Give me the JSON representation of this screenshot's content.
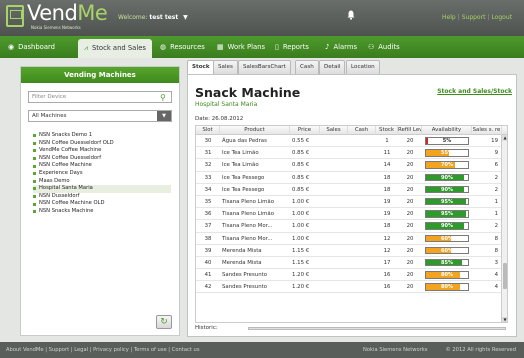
{
  "header": {
    "logo_main": "Vend",
    "logo_accent": "Me",
    "logo_sub": "Nokia Siemens Networks",
    "welcome_prefix": "Welcome:",
    "welcome_user": "test test",
    "links": [
      "Help",
      "Support",
      "Logout"
    ]
  },
  "nav": {
    "items": [
      {
        "label": "Dashboard",
        "icon": "eye-icon"
      },
      {
        "label": "Stock and Sales",
        "icon": "chart-icon"
      },
      {
        "label": "Resources",
        "icon": "globe-icon"
      },
      {
        "label": "Work Plans",
        "icon": "calendar-icon"
      },
      {
        "label": "Reports",
        "icon": "document-icon"
      },
      {
        "label": "Alarms",
        "icon": "bell-icon"
      },
      {
        "label": "Audits",
        "icon": "users-icon"
      }
    ]
  },
  "left_panel": {
    "title": "Vending Machines",
    "filter_placeholder": "Filter Device",
    "select_value": "All Machines",
    "machines": [
      "NSN Snacks Demo 1",
      "NSN Coffee Duesseldorf OLD",
      "VendMe Coffee Machine",
      "NSN Coffee Duesseldorf",
      "NSN Coffee Machine",
      "Experience Days",
      "Maas Demo",
      "Hospital Santa Maria",
      "NSN Dusseldorf",
      "NSN Coffee Machine OLD",
      "NSN Snacks Machine"
    ],
    "selected_index": 7
  },
  "tabs": [
    "Stock",
    "Sales",
    "SalesBarsChart",
    "Cash",
    "Detail",
    "Location Sales"
  ],
  "main": {
    "title": "Snack Machine",
    "subtitle": "Hospital Santa Maria",
    "date": "Date: 26.08.2012",
    "report_link": "Stock and Sales/Stock",
    "columns": [
      "Slot",
      "Product",
      "Price",
      "Sales",
      "Cash",
      "Stock",
      "Refill Lev",
      "Availability",
      "Sales s. re"
    ],
    "rows": [
      {
        "slot": "30",
        "product": "Água das Pedras",
        "price": "0.55 €",
        "stock": "1",
        "refill": "20",
        "avail": 5,
        "avail_label": "5%",
        "ssr": "19"
      },
      {
        "slot": "31",
        "product": "Ice Tea Limão",
        "price": "0.85 €",
        "stock": "11",
        "refill": "20",
        "avail": 55,
        "avail_label": "55%",
        "ssr": "9"
      },
      {
        "slot": "32",
        "product": "Ice Tea Limão",
        "price": "0.85 €",
        "stock": "14",
        "refill": "20",
        "avail": 70,
        "avail_label": "70%",
        "ssr": "6"
      },
      {
        "slot": "33",
        "product": "Ice Tea Pessego",
        "price": "0.85 €",
        "stock": "18",
        "refill": "20",
        "avail": 90,
        "avail_label": "90%",
        "ssr": "2"
      },
      {
        "slot": "34",
        "product": "Ice Tea Pessego",
        "price": "0.85 €",
        "stock": "18",
        "refill": "20",
        "avail": 90,
        "avail_label": "90%",
        "ssr": "2"
      },
      {
        "slot": "35",
        "product": "Tisana Pleno Limão",
        "price": "1.00 €",
        "stock": "19",
        "refill": "20",
        "avail": 95,
        "avail_label": "95%",
        "ssr": "1"
      },
      {
        "slot": "36",
        "product": "Tisana Pleno Limão",
        "price": "1.00 €",
        "stock": "19",
        "refill": "20",
        "avail": 95,
        "avail_label": "95%",
        "ssr": "1"
      },
      {
        "slot": "37",
        "product": "Tisana Pleno Mor...",
        "price": "1.00 €",
        "stock": "18",
        "refill": "20",
        "avail": 90,
        "avail_label": "90%",
        "ssr": "2"
      },
      {
        "slot": "38",
        "product": "Tisana Pleno Mor...",
        "price": "1.00 €",
        "stock": "12",
        "refill": "20",
        "avail": 60,
        "avail_label": "60%",
        "ssr": "8"
      },
      {
        "slot": "39",
        "product": "Merenda Mista",
        "price": "1.15 €",
        "stock": "12",
        "refill": "20",
        "avail": 60,
        "avail_label": "60%",
        "ssr": "8"
      },
      {
        "slot": "40",
        "product": "Merenda Mista",
        "price": "1.15 €",
        "stock": "17",
        "refill": "20",
        "avail": 85,
        "avail_label": "85%",
        "ssr": "3"
      },
      {
        "slot": "41",
        "product": "Sandes Presunto",
        "price": "1.20 €",
        "stock": "16",
        "refill": "20",
        "avail": 80,
        "avail_label": "80%",
        "ssr": "4"
      },
      {
        "slot": "42",
        "product": "Sandes Presunto",
        "price": "1.20 €",
        "stock": "16",
        "refill": "20",
        "avail": 80,
        "avail_label": "80%",
        "ssr": "4"
      }
    ],
    "historic_label": "Historic:"
  },
  "footer": {
    "links": [
      "About VendMe",
      "Support",
      "Legal",
      "Privacy policy",
      "Terms of use",
      "Contact us"
    ],
    "nsn": "Nokia Siemens Networks",
    "copyright": "© 2012 All rights Reserved"
  },
  "colors": {
    "accent_green": "#4e9a2c",
    "bar_red": "#cc2a1e",
    "bar_orange": "#f2a31f",
    "bar_green": "#2e9a2a"
  }
}
